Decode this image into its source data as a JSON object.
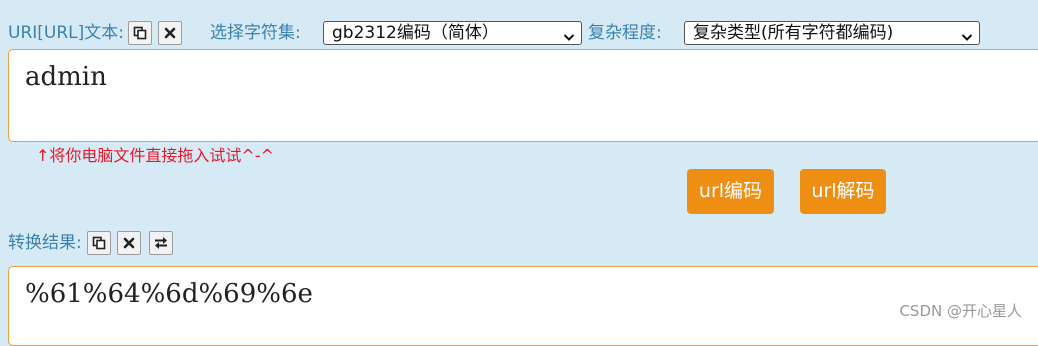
{
  "input_section": {
    "label": "URI[URL]文本:",
    "copy_icon": "copy-icon",
    "clear_icon": "close-icon",
    "value": "admin"
  },
  "charset": {
    "label": "选择字符集:",
    "selected": "gb2312编码（简体）"
  },
  "complexity": {
    "label": "复杂程度:",
    "selected": "复杂类型(所有字符都编码)"
  },
  "hint": "↑将你电脑文件直接拖入试试^-^",
  "buttons": {
    "encode": "url编码",
    "decode": "url解码"
  },
  "result_section": {
    "label": "转换结果:",
    "copy_icon": "copy-icon",
    "clear_icon": "close-icon",
    "swap_icon": "swap-icon",
    "value": "%61%64%6d%69%6e"
  },
  "watermark": "CSDN @开心星人",
  "colors": {
    "background": "#d6eaf5",
    "label": "#3b82b0",
    "accent_button": "#ee8f14",
    "textbox_border": "#e2a23a",
    "hint": "#e8182a"
  }
}
